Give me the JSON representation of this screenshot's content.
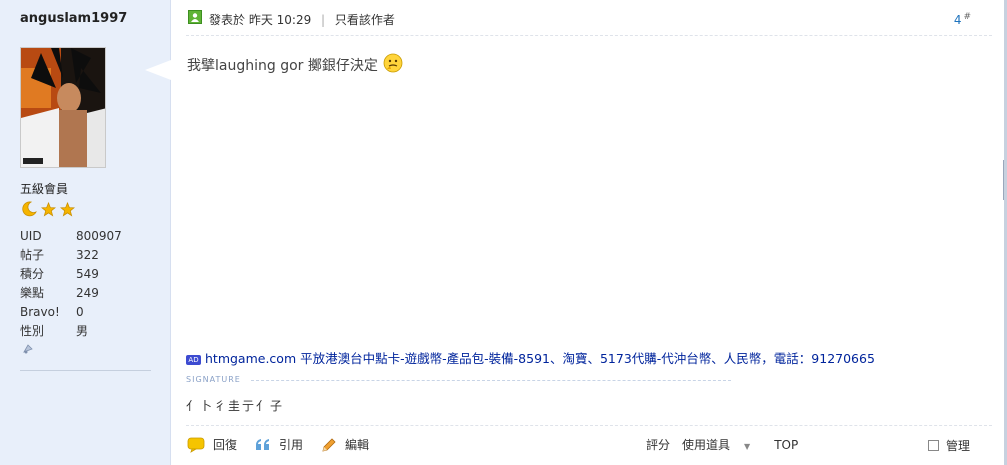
{
  "user": {
    "username": "anguslam1997",
    "rank": "五級會員",
    "stats": [
      {
        "label": "UID",
        "value": "800907"
      },
      {
        "label": "帖子",
        "value": "322"
      },
      {
        "label": "積分",
        "value": "549"
      },
      {
        "label": "樂點",
        "value": "249"
      },
      {
        "label": "Bravo!",
        "value": "0"
      },
      {
        "label": "性別",
        "value": "男"
      }
    ],
    "star_icons": [
      "moon-icon",
      "star-icon",
      "star-icon"
    ]
  },
  "post": {
    "posted_prefix": "發表於 昨天 10:29",
    "separator": "|",
    "author_only": "只看該作者",
    "floor": "4",
    "floor_mark": "#",
    "content": "我擘laughing gor 擲銀仔決定",
    "ad": {
      "badge": "AD",
      "site": "htmgame.com",
      "text": " 平放港澳台中點卡-遊戲幣-產品包-裝備-8591、淘寶、5173代購-代沖台幣、人民幣，電話：91270665"
    },
    "signature_label": "SIGNATURE",
    "signature": "亻卜彳圭亍亻子"
  },
  "actions": {
    "reply": "回復",
    "quote": "引用",
    "edit": "編輯",
    "rate": "評分",
    "use_item": "使用道具",
    "top": "TOP",
    "manage": "管理"
  },
  "colors": {
    "sidebar_bg": "#e8effa",
    "link_blue": "#00249c",
    "floor_blue": "#1e73be",
    "star_gold": "#f5b400"
  }
}
